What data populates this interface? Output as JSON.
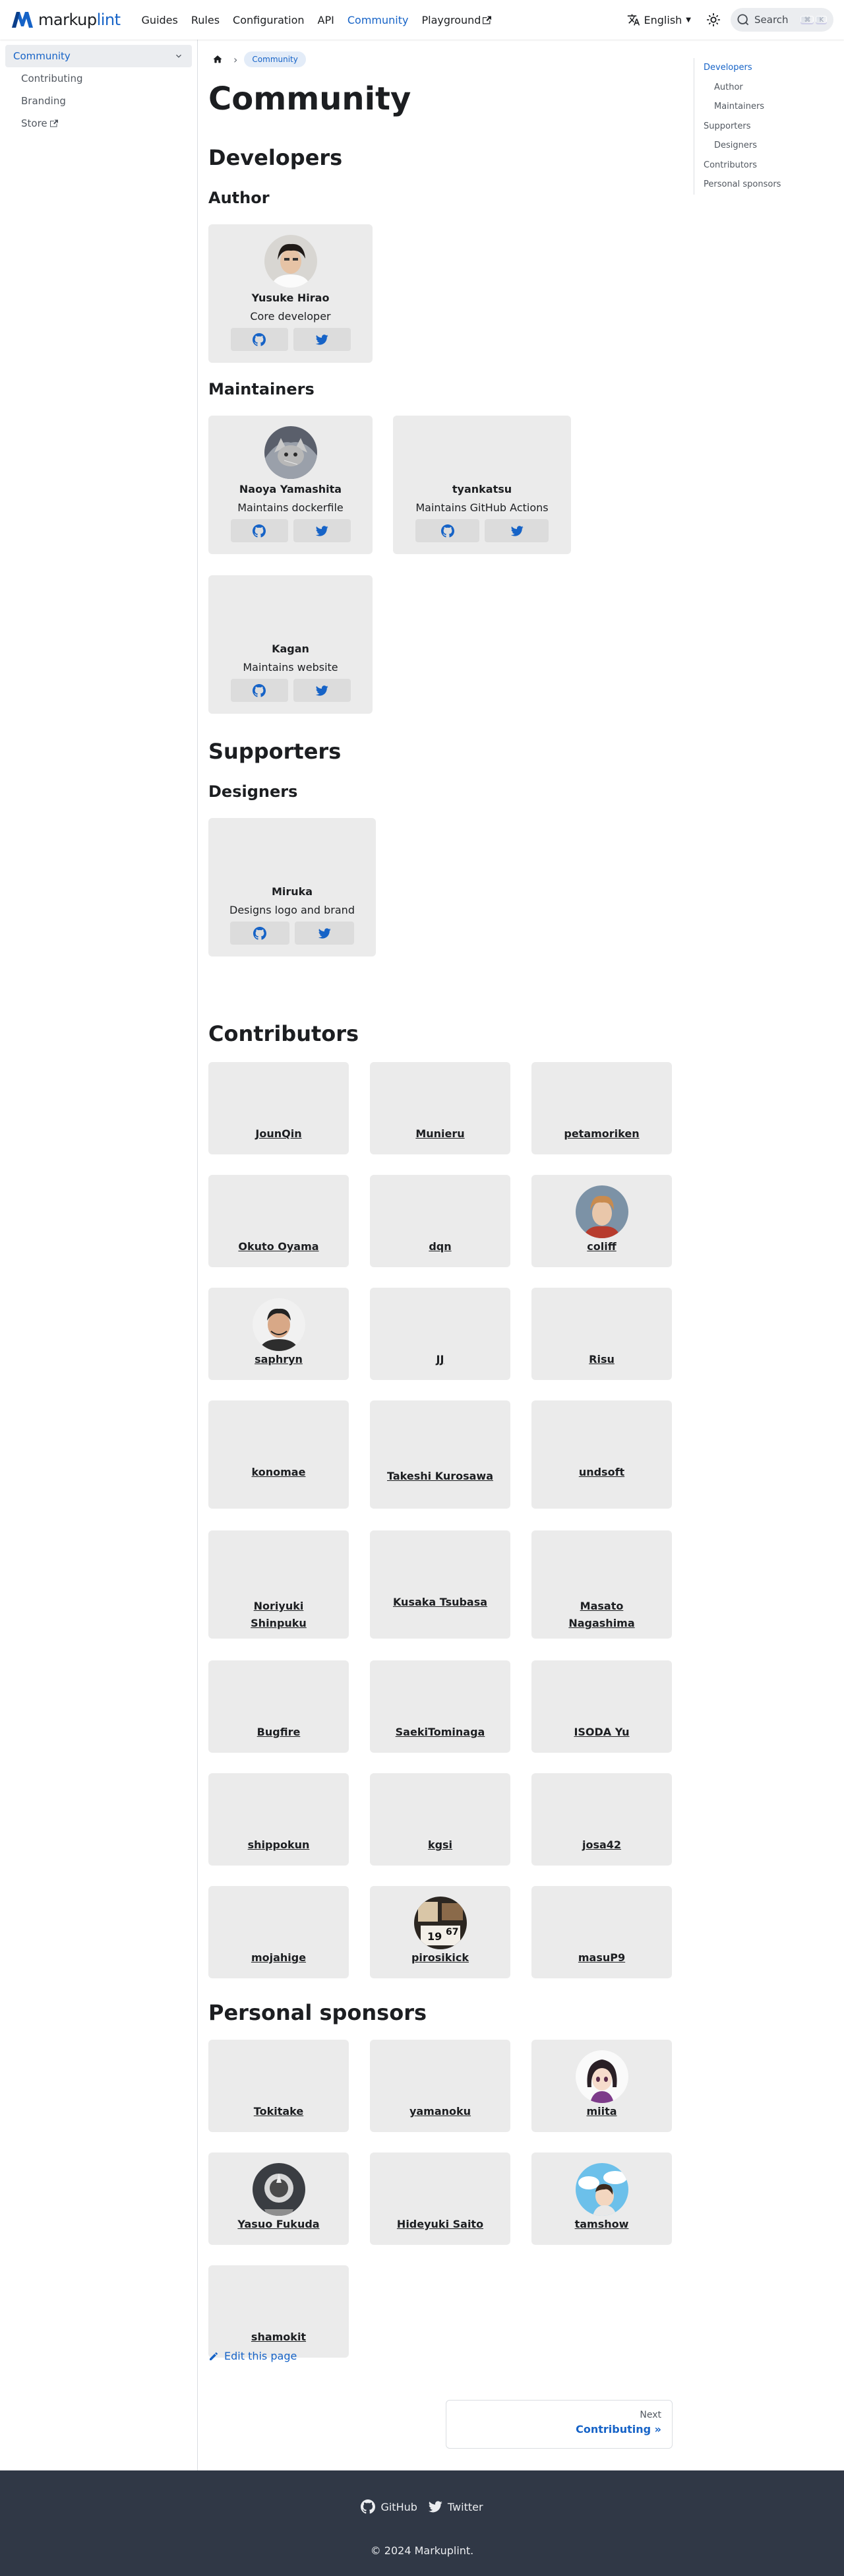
{
  "brand": {
    "prefix": "markup",
    "suffix": "lint",
    "accent": "#1663c7"
  },
  "navbar": {
    "links": [
      "Guides",
      "Rules",
      "Configuration",
      "API",
      "Community",
      "Playground"
    ],
    "active": "Community",
    "language": "English",
    "search_placeholder": "Search",
    "search_keys": [
      "⌘",
      "K"
    ]
  },
  "sidebar": {
    "items": [
      {
        "label": "Community",
        "active": true
      },
      {
        "label": "Contributing"
      },
      {
        "label": "Branding"
      },
      {
        "label": "Store"
      }
    ]
  },
  "toc": {
    "items": [
      "Developers",
      "Author",
      "Maintainers",
      "Supporters",
      "Designers",
      "Contributors",
      "Personal sponsors"
    ]
  },
  "breadcrumb": {
    "current": "Community"
  },
  "page": {
    "title": "Community",
    "developers_heading": "Developers",
    "author_heading": "Author",
    "maintainers_heading": "Maintainers",
    "supporters_heading": "Supporters",
    "designers_heading": "Designers",
    "contributors_heading": "Contributors",
    "sponsors_heading": "Personal sponsors"
  },
  "author": {
    "name": "Yusuke Hirao",
    "role": "Core developer"
  },
  "maintainers": [
    {
      "name": "Naoya Yamashita",
      "role": "Maintains dockerfile"
    },
    {
      "name": "tyankatsu",
      "role": "Maintains GitHub Actions"
    },
    {
      "name": "Kagan",
      "role": "Maintains website"
    }
  ],
  "designers": [
    {
      "name": "Miruka",
      "role": "Designs logo and brand"
    }
  ],
  "contributors": [
    "JounQin",
    "Munieru",
    "petamoriken",
    "Okuto Oyama",
    "dqn",
    "coliff",
    "saphryn",
    "JJ",
    "Risu",
    "konomae",
    "Takeshi Kurosawa",
    "undsoft",
    "Noriyuki Shinpuku",
    "Kusaka Tsubasa",
    "Masato Nagashima",
    "Bugfire",
    "SaekiTominaga",
    "ISODA Yu",
    "shippokun",
    "kgsi",
    "josa42",
    "mojahige",
    "pirosikick",
    "masuP9"
  ],
  "sponsors": [
    "Tokitake",
    "yamanoku",
    "miita",
    "Yasuo Fukuda",
    "Hideyuki Saito",
    "tamshow",
    "shamokit"
  ],
  "edit_link": "Edit this page",
  "pagination": {
    "label": "Next",
    "title": "Contributing »"
  },
  "footer": {
    "links": [
      "GitHub",
      "Twitter"
    ],
    "copyright": "© 2024 Markuplint."
  }
}
